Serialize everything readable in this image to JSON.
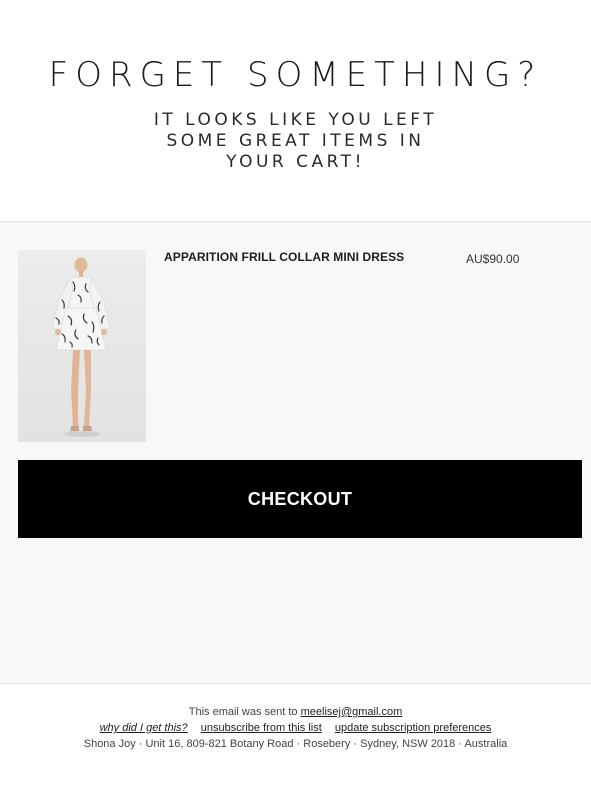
{
  "header": {
    "title": "FORGET SOMETHING?",
    "subtitle_lines": [
      "IT LOOKS LIKE YOU LEFT",
      "SOME GREAT ITEMS IN",
      "YOUR CART!"
    ]
  },
  "cart": {
    "items": [
      {
        "name": "APPARITION FRILL COLLAR MINI DRESS",
        "price": "AU$90.00"
      }
    ],
    "checkout_label": "CHECKOUT"
  },
  "footer": {
    "sent_prefix": "This email was sent to",
    "email": "meelisej@gmail.com",
    "why_link": "why did I get this?",
    "unsubscribe_link": "unsubscribe from this list",
    "preferences_link": "update subscription preferences",
    "address": "Shona Joy · Unit 16, 809-821 Botany Road · Rosebery · Sydney, NSW 2018 · Australia"
  },
  "colors": {
    "checkout_bg": "#000000",
    "cart_bg": "#f8f8f8",
    "page_bg": "#ffffff"
  }
}
